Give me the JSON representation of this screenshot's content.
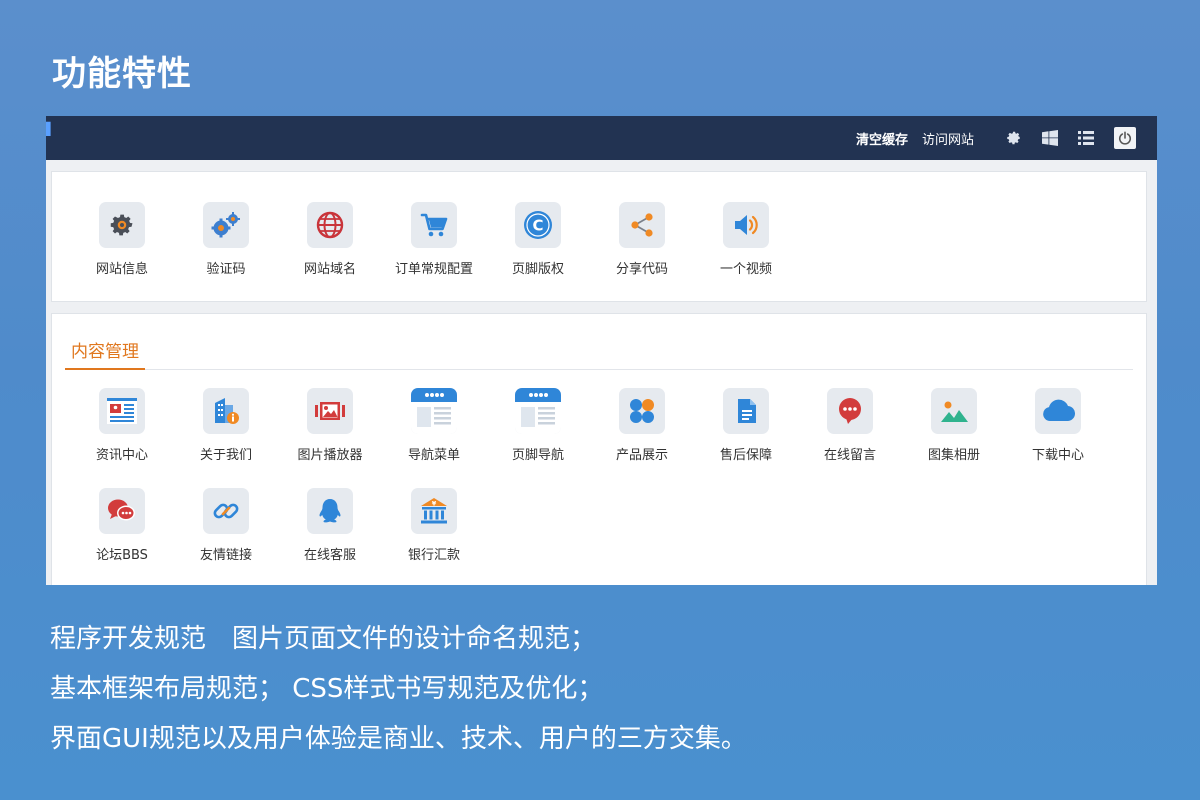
{
  "slide": {
    "title": "功能特性",
    "description": [
      "程序开发规范　图片页面文件的设计命名规范；",
      "基本框架布局规范； CSS样式书写规范及优化；",
      "界面GUI规范以及用户体验是商业、技术、用户的三方交集。"
    ]
  },
  "topbar": {
    "clear_cache": "清空缓存",
    "visit_site": "访问网站",
    "icons": [
      "gear-icon",
      "windows-icon",
      "list-icon",
      "power-icon"
    ]
  },
  "settings_panel": {
    "items": [
      {
        "label": "网站信息",
        "icon": "gear-icon"
      },
      {
        "label": "验证码",
        "icon": "gears-icon"
      },
      {
        "label": "网站域名",
        "icon": "globe-icon"
      },
      {
        "label": "订单常规配置",
        "icon": "cart-icon"
      },
      {
        "label": "页脚版权",
        "icon": "copyright-icon"
      },
      {
        "label": "分享代码",
        "icon": "share-icon"
      },
      {
        "label": "一个视频",
        "icon": "speaker-icon"
      }
    ]
  },
  "content_panel": {
    "tab": "内容管理",
    "items": [
      {
        "label": "资讯中心",
        "icon": "news-icon"
      },
      {
        "label": "关于我们",
        "icon": "building-info-icon"
      },
      {
        "label": "图片播放器",
        "icon": "picture-player-icon"
      },
      {
        "label": "导航菜单",
        "icon": "navigation-menu-icon"
      },
      {
        "label": "页脚导航",
        "icon": "footer-nav-icon"
      },
      {
        "label": "产品展示",
        "icon": "product-grid-icon"
      },
      {
        "label": "售后保障",
        "icon": "document-icon"
      },
      {
        "label": "在线留言",
        "icon": "message-bubble-icon"
      },
      {
        "label": "图集相册",
        "icon": "album-icon"
      },
      {
        "label": "下载中心",
        "icon": "cloud-icon"
      },
      {
        "label": "论坛BBS",
        "icon": "chat-bubbles-icon"
      },
      {
        "label": "友情链接",
        "icon": "link-icon"
      },
      {
        "label": "在线客服",
        "icon": "qq-penguin-icon"
      },
      {
        "label": "银行汇款",
        "icon": "bank-icon"
      }
    ]
  },
  "colors": {
    "topbar": "#223352",
    "accent_orange": "#e0771e",
    "icon_blue": "#3d8fe0"
  }
}
